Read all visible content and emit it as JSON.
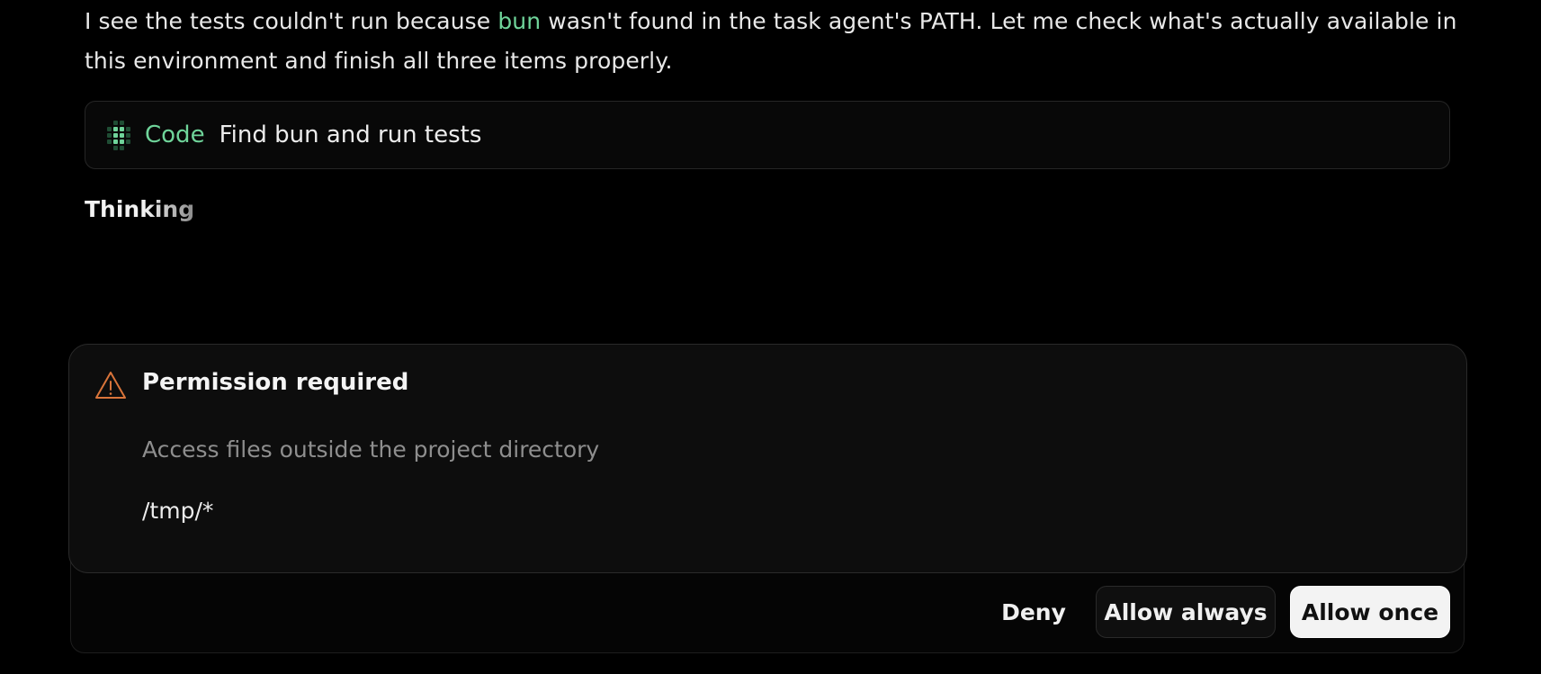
{
  "message": {
    "text_before": "I see the tests couldn't run because ",
    "code": "bun",
    "text_after": " wasn't found in the task agent's PATH. Let me check what's actually available in this environment and finish all three items properly."
  },
  "tool_call": {
    "kind": "Code",
    "title": "Find bun and run tests",
    "icon": "code-grid-icon"
  },
  "status": {
    "thinking": "Thinking"
  },
  "permission": {
    "title": "Permission required",
    "description": "Access files outside the project directory",
    "path": "/tmp/*",
    "icon": "warning-icon",
    "buttons": {
      "deny": "Deny",
      "allow_always": "Allow always",
      "allow_once": "Allow once"
    }
  },
  "colors": {
    "accent_green": "#6fd49a",
    "warning_orange": "#d9743a",
    "background": "#000000"
  }
}
